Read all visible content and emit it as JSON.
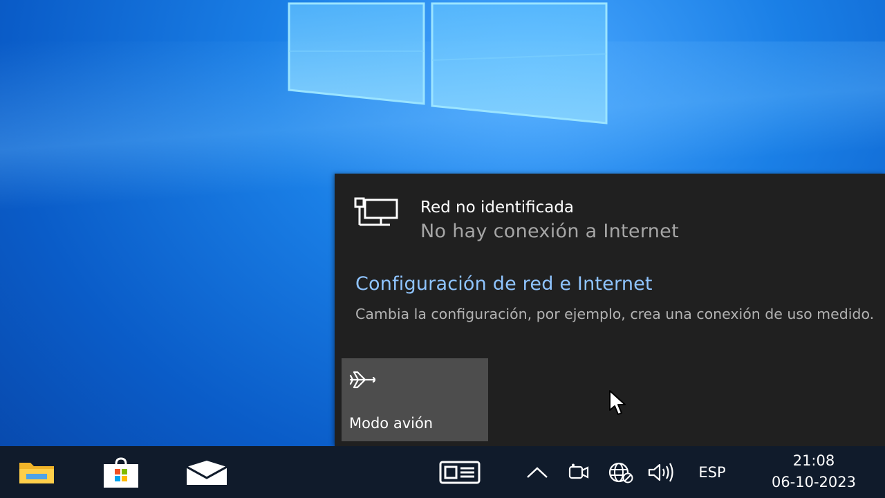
{
  "flyout": {
    "network_name": "Red no identificada",
    "network_status": "No hay conexión a Internet",
    "settings_link": "Configuración de red e Internet",
    "settings_description": "Cambia la configuración, por ejemplo, crea una conexión de uso medido.",
    "quick_action": {
      "label": "Modo avión",
      "icon": "airplane-icon"
    }
  },
  "taskbar": {
    "apps": [
      "file-explorer-icon",
      "microsoft-store-icon",
      "mail-icon",
      "news-widget-icon"
    ],
    "tray_icons": [
      "chevron-up-icon",
      "meet-now-icon",
      "globe-network-icon",
      "volume-icon"
    ],
    "language": "ESP",
    "time": "21:08",
    "date": "06-10-2023"
  },
  "colors": {
    "flyout_bg": "#202020",
    "tile_bg": "#4d4d4d",
    "link": "#8fc4ff",
    "taskbar_bg": "#101b2b"
  }
}
